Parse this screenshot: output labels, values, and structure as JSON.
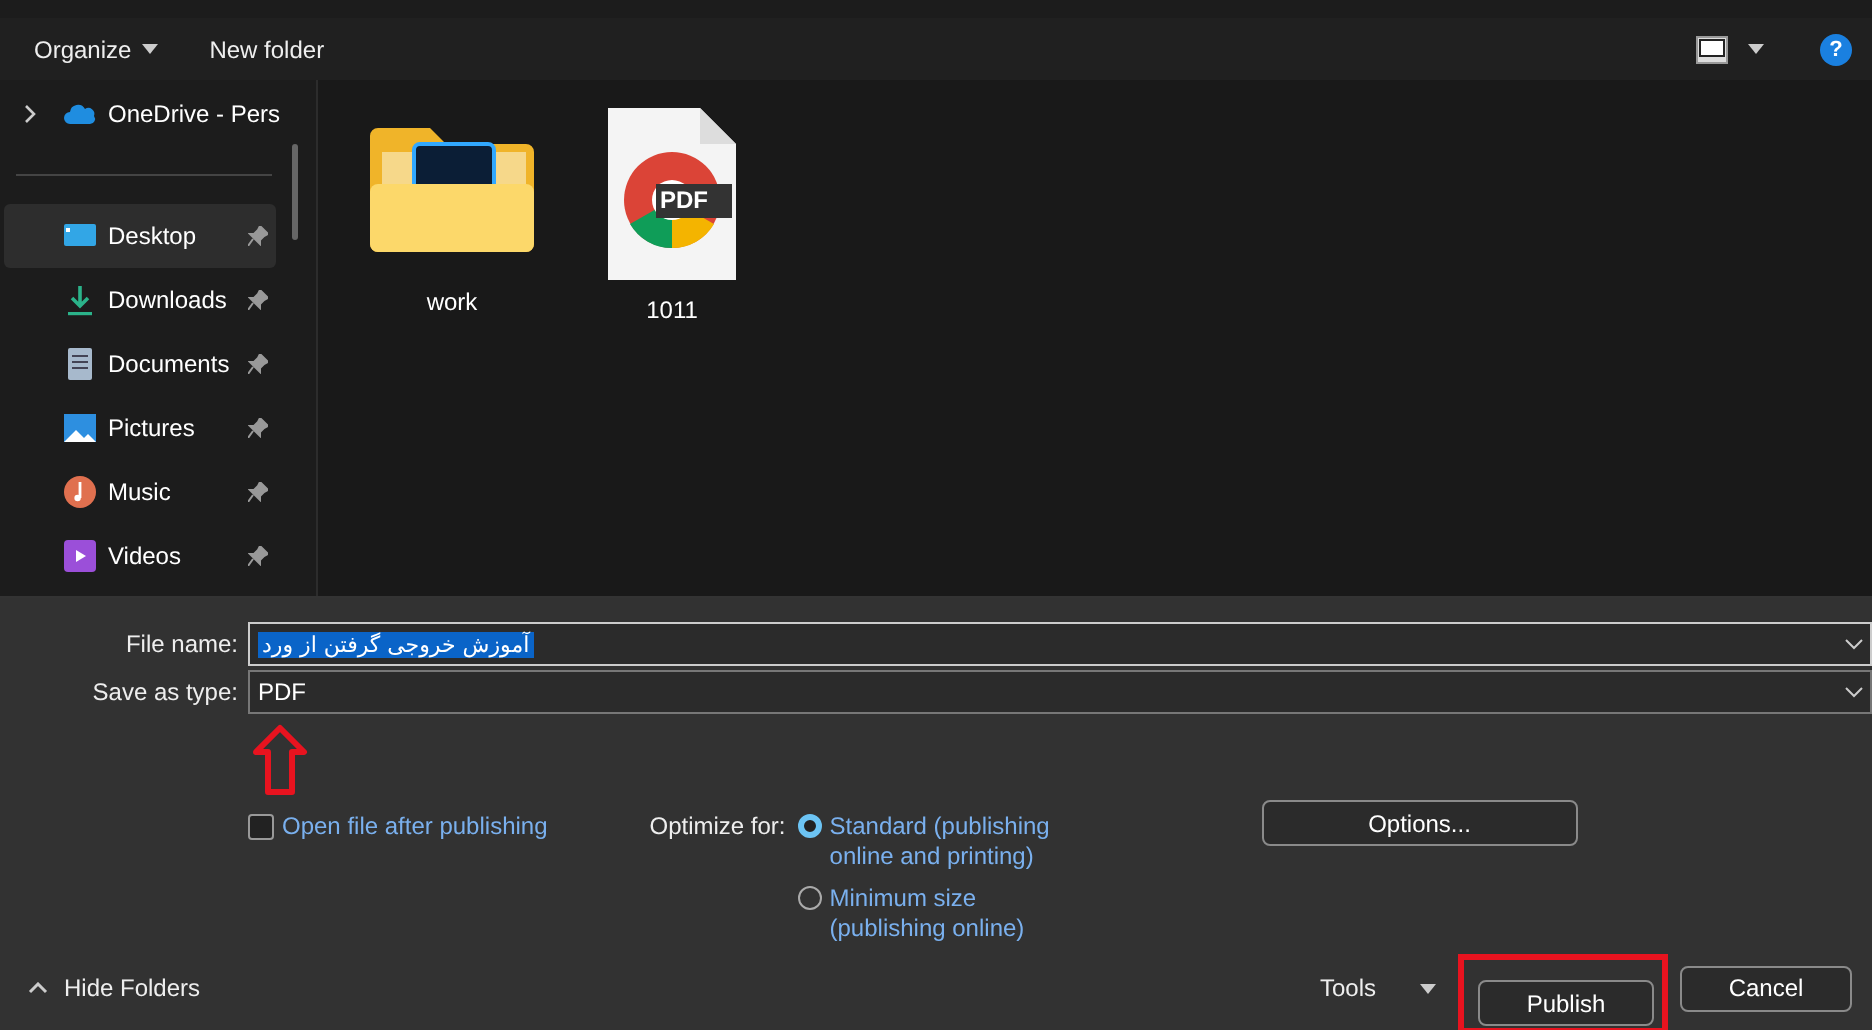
{
  "toolbar": {
    "organize": "Organize",
    "new_folder": "New folder",
    "help": "?"
  },
  "sidebar": {
    "items": [
      {
        "label": "OneDrive - Pers",
        "kind": "cloud",
        "pinned": false,
        "selected": false
      },
      {
        "label": "Desktop",
        "kind": "desktop",
        "pinned": true,
        "selected": true
      },
      {
        "label": "Downloads",
        "kind": "download",
        "pinned": true,
        "selected": false
      },
      {
        "label": "Documents",
        "kind": "document",
        "pinned": true,
        "selected": false
      },
      {
        "label": "Pictures",
        "kind": "picture",
        "pinned": true,
        "selected": false
      },
      {
        "label": "Music",
        "kind": "music",
        "pinned": true,
        "selected": false
      },
      {
        "label": "Videos",
        "kind": "video",
        "pinned": true,
        "selected": false
      }
    ]
  },
  "files": [
    {
      "name": "work",
      "kind": "folder"
    },
    {
      "name": "1011",
      "kind": "pdf",
      "badge": "PDF"
    }
  ],
  "form": {
    "file_name_label": "File name:",
    "file_name": "آموزش خروجی گرفتن از ورد",
    "save_type_label": "Save as type:",
    "save_type": "PDF",
    "open_after": {
      "label": "Open file after publishing",
      "checked": false
    },
    "optimize_label": "Optimize for:",
    "optimize": [
      {
        "label": "Standard (publishing online and printing)",
        "selected": true
      },
      {
        "label": "Minimum size (publishing online)",
        "selected": false
      }
    ],
    "options_button": "Options..."
  },
  "footer": {
    "hide_folders": "Hide Folders",
    "tools": "Tools",
    "publish": "Publish",
    "cancel": "Cancel"
  }
}
